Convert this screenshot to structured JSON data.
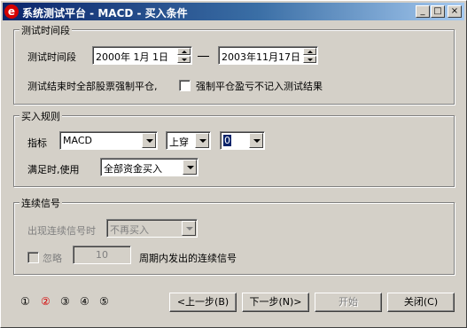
{
  "window": {
    "title": "系统测试平台 - MACD - 买入条件",
    "controls": {
      "minimize": "_",
      "maximize": "□",
      "close": "×"
    }
  },
  "test_period": {
    "group_title": "测试时间段",
    "label": "测试时间段",
    "start_date": "2000年 1月 1日",
    "separator": "—",
    "end_date": "2003年11月17日",
    "note": "测试结束时全部股票强制平仓,",
    "checkbox_label": "强制平仓盈亏不记入测试结果",
    "checkbox_checked": false
  },
  "buy_rules": {
    "group_title": "买入规则",
    "indicator_label": "指标",
    "indicator_value": "MACD",
    "cross_value": "上穿",
    "threshold_value": "0",
    "use_label": "满足时,使用",
    "funds_value": "全部资金买入"
  },
  "continuous_signal": {
    "group_title": "连续信号",
    "label": "出现连续信号时",
    "select_value": "不再买入",
    "ignore_label": "忽略",
    "ignore_checked": false,
    "period_value": "10",
    "period_suffix": "周期内发出的连续信号"
  },
  "steps": [
    {
      "label": "①",
      "color": "#000000"
    },
    {
      "label": "②",
      "color": "#d40000"
    },
    {
      "label": "③",
      "color": "#000000"
    },
    {
      "label": "④",
      "color": "#000000"
    },
    {
      "label": "⑤",
      "color": "#000000"
    }
  ],
  "buttons": {
    "prev": "<上一步(B)",
    "next": "下一步(N)>",
    "start": "开始",
    "close": "关闭(C)"
  }
}
